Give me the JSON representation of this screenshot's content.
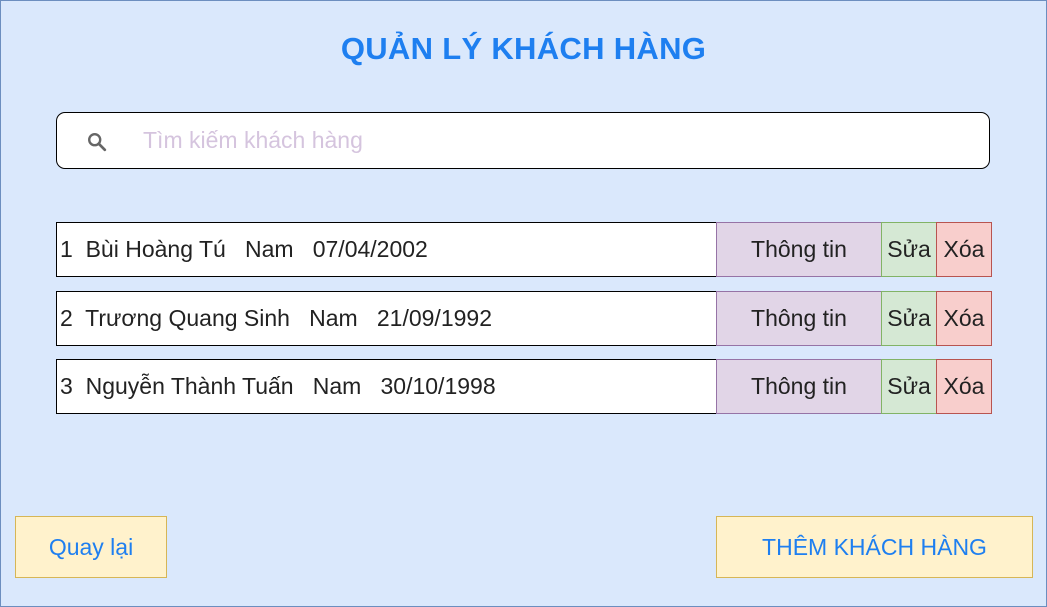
{
  "header": {
    "title": "QUẢN LÝ KHÁCH HÀNG"
  },
  "search": {
    "placeholder": "Tìm kiếm khách hàng",
    "icon": "search-icon"
  },
  "customers": [
    {
      "index": "1",
      "name": "Bùi Hoàng Tú",
      "gender": "Nam",
      "dob": "07/04/2002",
      "info_label": "Thông tin",
      "edit_label": "Sửa",
      "delete_label": "Xóa"
    },
    {
      "index": "2",
      "name": "Trương Quang Sinh",
      "gender": "Nam",
      "dob": "21/09/1992",
      "info_label": "Thông tin",
      "edit_label": "Sửa",
      "delete_label": "Xóa"
    },
    {
      "index": "3",
      "name": "Nguyễn Thành Tuấn",
      "gender": "Nam",
      "dob": "30/10/1998",
      "info_label": "Thông tin",
      "edit_label": "Sửa",
      "delete_label": "Xóa"
    }
  ],
  "footer": {
    "back_label": "Quay lại",
    "add_label": "THÊM KHÁCH HÀNG"
  },
  "colors": {
    "background": "#dae8fc",
    "accent": "#1e7ff0",
    "info_button": "#e1d5e7",
    "edit_button": "#d5e8d4",
    "delete_button": "#f8cecc",
    "footer_button": "#fff2cc"
  }
}
